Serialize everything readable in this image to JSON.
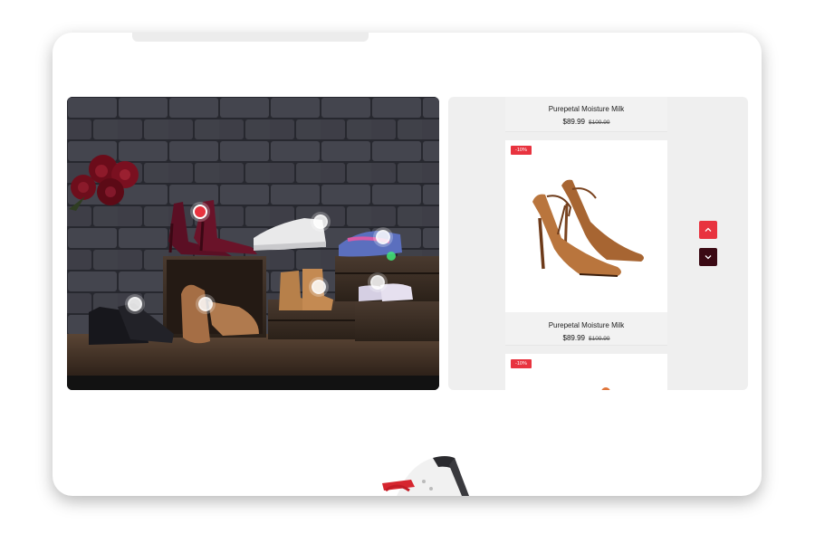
{
  "products": [
    {
      "name": "Purepetal Moisture Milk",
      "price": "$89.99",
      "old_price": "$109.99"
    },
    {
      "name": "Purepetal Moisture Milk",
      "price": "$89.99",
      "old_price": "$109.99",
      "badge": "-10%"
    },
    {
      "badge": "-10%"
    }
  ],
  "icons": {
    "slider_up": "chevron-up-icon",
    "slider_down": "chevron-down-icon",
    "hotspot": "plus-dot-icon"
  },
  "colors": {
    "accent": "#e8333f",
    "dark_accent": "#3b0a14",
    "panel_bg": "#efefef"
  }
}
